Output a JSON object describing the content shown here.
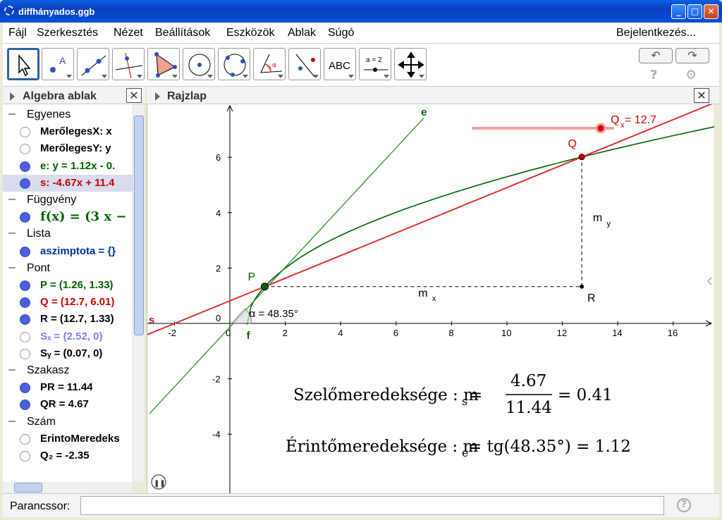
{
  "window": {
    "title": "diffhányados.ggb",
    "minimize": "_",
    "maximize": "□",
    "close": "✕"
  },
  "menu": {
    "items": [
      "Fájl",
      "Szerkesztés",
      "Nézet",
      "Beállítások",
      "Eszközök",
      "Ablak",
      "Súgó"
    ],
    "login": "Bejelentkezés..."
  },
  "toolbar": {
    "tools": [
      "move-tool",
      "point-tool",
      "line-tool",
      "perpendicular-tool",
      "polygon-tool",
      "circle-tool",
      "conic-tool",
      "angle-tool",
      "reflect-tool",
      "text-tool",
      "slider-tool",
      "move-graphics-tool"
    ],
    "text_tool_label": "ABC",
    "slider_tool_label": "a = 2",
    "undo": "↶",
    "redo": "↷",
    "help": "?",
    "settings": "⚙"
  },
  "algebra": {
    "title": "Algebra ablak",
    "rows": [
      {
        "type": "cat",
        "text": "Egyenes"
      },
      {
        "type": "item",
        "text": "MerőlegesX: x",
        "color": "#000000",
        "visible": false
      },
      {
        "type": "item",
        "text": "MerőlegesY: y",
        "color": "#000000",
        "visible": false
      },
      {
        "type": "item",
        "text": "e: y = 1.12x - 0.",
        "color": "#006400",
        "visible": true
      },
      {
        "type": "item",
        "text": "s: -4.67x + 11.4",
        "color": "#cc0000",
        "visible": true,
        "selected": true
      },
      {
        "type": "cat",
        "text": "Függvény"
      },
      {
        "type": "item",
        "text": "f(x) = (3 x −",
        "color": "#006400",
        "visible": true,
        "formula": true
      },
      {
        "type": "cat",
        "text": "Lista"
      },
      {
        "type": "item",
        "text": "aszimptota = {}",
        "color": "#003399",
        "visible": true
      },
      {
        "type": "cat",
        "text": "Pont"
      },
      {
        "type": "item",
        "text": "P = (1.26, 1.33)",
        "color": "#006400",
        "visible": true
      },
      {
        "type": "item",
        "text": "Q = (12.7, 6.01)",
        "color": "#cc0000",
        "visible": true
      },
      {
        "type": "item",
        "text": "R = (12.7, 1.33)",
        "color": "#000000",
        "visible": true
      },
      {
        "type": "item",
        "text": "Sₓ = (2.52, 0)",
        "color": "#7f7fff",
        "visible": false
      },
      {
        "type": "item",
        "text": "Sᵧ = (0.07, 0)",
        "color": "#000000",
        "visible": false
      },
      {
        "type": "cat",
        "text": "Szakasz"
      },
      {
        "type": "item",
        "text": "PR = 11.44",
        "color": "#000000",
        "visible": true
      },
      {
        "type": "item",
        "text": "QR = 4.67",
        "color": "#000000",
        "visible": true
      },
      {
        "type": "cat",
        "text": "Szám"
      },
      {
        "type": "item",
        "text": "ErintoMeredeks",
        "color": "#000000",
        "visible": false
      },
      {
        "type": "item",
        "text": "Q₂ = -2.35",
        "color": "#000000",
        "visible": false
      }
    ]
  },
  "graphics": {
    "title": "Rajzlap",
    "x_ticks": [
      "-2",
      "0",
      "2",
      "4",
      "6",
      "8",
      "10",
      "12",
      "14",
      "16"
    ],
    "y_ticks": [
      "6",
      "4",
      "2",
      "0",
      "-2",
      "-4"
    ],
    "labels": {
      "e": "e",
      "s": "s",
      "f": "f",
      "P": "P",
      "Q": "Q",
      "R": "R",
      "mx": "m",
      "mx_sub": "x",
      "my": "m",
      "my_sub": "y",
      "alpha": "α = 48.35°"
    },
    "slider": {
      "label": "Q",
      "label_sub": "x",
      "value_text": " = 12.7",
      "value": 12.7
    },
    "formula1": {
      "prefix": "Szelőmeredeksége : m",
      "sub": "s",
      "eq": " =",
      "num": "4.67",
      "den": "11.44",
      "result": "= 0.41"
    },
    "formula2": {
      "text": "Érintőmeredeksége : m",
      "sub": "e",
      "rest": " = tg(48.35°) = 1.12"
    },
    "colors": {
      "secant": "#e03030",
      "tangent": "#1a8a1a",
      "curve": "#006400",
      "point_q": "#cc0000",
      "point_p": "#006400"
    },
    "pause": "❚❚"
  },
  "command": {
    "label": "Parancssor:",
    "value": "",
    "help": "?"
  }
}
